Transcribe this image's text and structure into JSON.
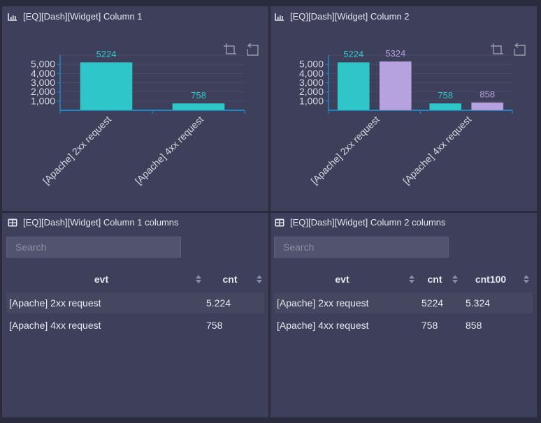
{
  "widgets": {
    "chart1": {
      "title": "[EQ][Dash][Widget] Column 1",
      "icon": "bar-chart-icon",
      "tools": [
        "crop-icon",
        "undo-icon"
      ]
    },
    "chart2": {
      "title": "[EQ][Dash][Widget] Column 2",
      "icon": "bar-chart-icon",
      "tools": [
        "crop-icon",
        "undo-icon"
      ]
    },
    "table1": {
      "title": "[EQ][Dash][Widget] Column 1 columns",
      "icon": "table-icon",
      "search_placeholder": "Search",
      "columns": [
        "evt",
        "cnt"
      ],
      "rows": [
        [
          "[Apache] 2xx request",
          "5.224"
        ],
        [
          "[Apache] 4xx request",
          "758"
        ]
      ]
    },
    "table2": {
      "title": "[EQ][Dash][Widget] Column 2 columns",
      "icon": "table-icon",
      "search_placeholder": "Search",
      "columns": [
        "evt",
        "cnt",
        "cnt100"
      ],
      "rows": [
        [
          "[Apache] 2xx request",
          "5224",
          "5.324"
        ],
        [
          "[Apache] 4xx request",
          "758",
          "858"
        ]
      ]
    }
  },
  "colors": {
    "series1": "#2ec6c8",
    "series2": "#b6a2de",
    "axis": "#1e88c7"
  },
  "chart_data": [
    {
      "type": "bar",
      "title": "[EQ][Dash][Widget] Column 1",
      "categories": [
        "[Apache] 2xx request",
        "[Apache] 4xx request"
      ],
      "series": [
        {
          "name": "cnt",
          "values": [
            5224,
            758
          ]
        }
      ],
      "yticks": [
        "1,000",
        "2,000",
        "3,000",
        "4,000",
        "5,000"
      ],
      "ylim": [
        0,
        6000
      ],
      "grid": true,
      "xlabel": "",
      "ylabel": ""
    },
    {
      "type": "bar",
      "title": "[EQ][Dash][Widget] Column 2",
      "categories": [
        "[Apache] 2xx request",
        "[Apache] 4xx request"
      ],
      "series": [
        {
          "name": "cnt",
          "values": [
            5224,
            758
          ]
        },
        {
          "name": "cnt100",
          "values": [
            5324,
            858
          ]
        }
      ],
      "yticks": [
        "1,000",
        "2,000",
        "3,000",
        "4,000",
        "5,000"
      ],
      "ylim": [
        0,
        6000
      ],
      "grid": true,
      "xlabel": "",
      "ylabel": ""
    }
  ]
}
